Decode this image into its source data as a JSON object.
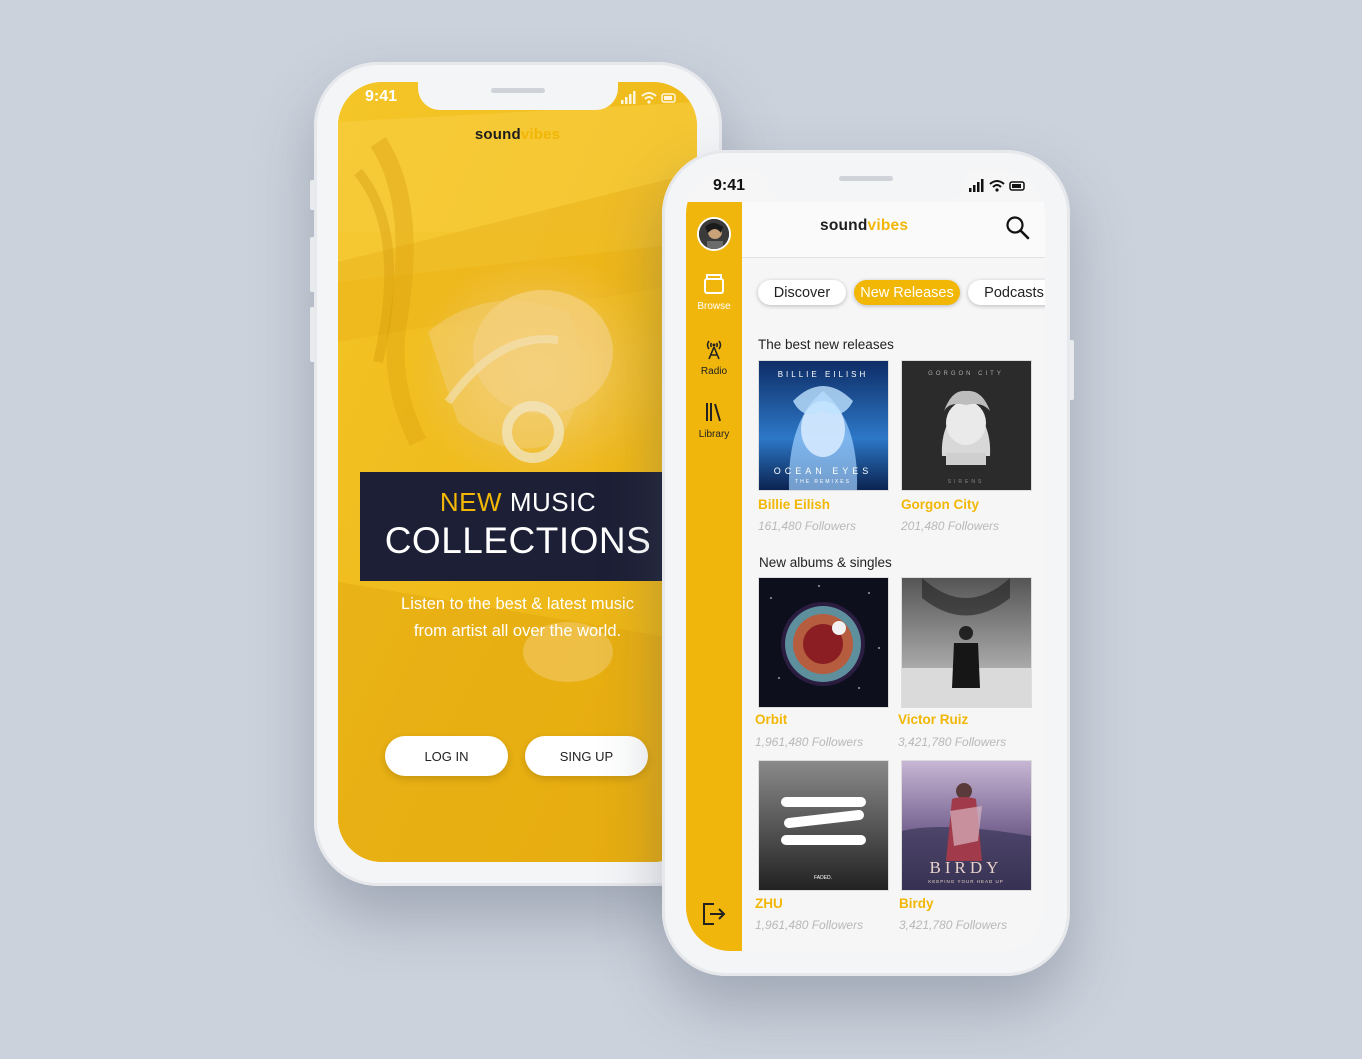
{
  "status_bar": {
    "time": "9:41"
  },
  "brand": {
    "part1": "sound",
    "part2": "vibes"
  },
  "welcome": {
    "title_highlight": "NEW",
    "title_rest": "MUSIC",
    "title_line2": "COLLECTIONS",
    "subtitle_line1": "Listen to the best & latest music",
    "subtitle_line2": "from artist all over the world.",
    "login_label": "LOG IN",
    "signup_label": "SING UP"
  },
  "sidebar": {
    "items": [
      {
        "label": "Browse",
        "icon": "browse-icon"
      },
      {
        "label": "Radio",
        "icon": "radio-tower-icon"
      },
      {
        "label": "Library",
        "icon": "library-icon"
      }
    ],
    "logout_icon": "logout-icon"
  },
  "tabs": [
    {
      "label": "Discover",
      "active": false
    },
    {
      "label": "New Releases",
      "active": true
    },
    {
      "label": "Podcasts",
      "active": false
    }
  ],
  "sections": [
    {
      "title": "The best new releases",
      "items": [
        {
          "name": "Billie Eilish",
          "followers": "161,480 Followers",
          "cover_top": "BILLIE EILISH",
          "cover_bottom": "OCEAN EYES",
          "cover_sub": "THE REMIXES"
        },
        {
          "name": "Gorgon City",
          "followers": "201,480 Followers",
          "cover_top": "GORGON CITY",
          "cover_bottom": "SIRENS"
        }
      ]
    },
    {
      "title": "New albums & singles",
      "items": [
        {
          "name": "Orbit",
          "followers": "1,961,480 Followers"
        },
        {
          "name": "Victor Ruiz",
          "followers": "3,421,780 Followers"
        },
        {
          "name": "ZHU",
          "followers": "1,961,480 Followers",
          "cover_bottom": "FADED."
        },
        {
          "name": "Birdy",
          "followers": "3,421,780 Followers",
          "cover_text": "BIRDY",
          "cover_sub": "KEEPING YOUR HEAD UP"
        }
      ]
    }
  ],
  "colors": {
    "accent": "#f2b705",
    "dark": "#1c1f35",
    "background": "#cbd2dc"
  }
}
